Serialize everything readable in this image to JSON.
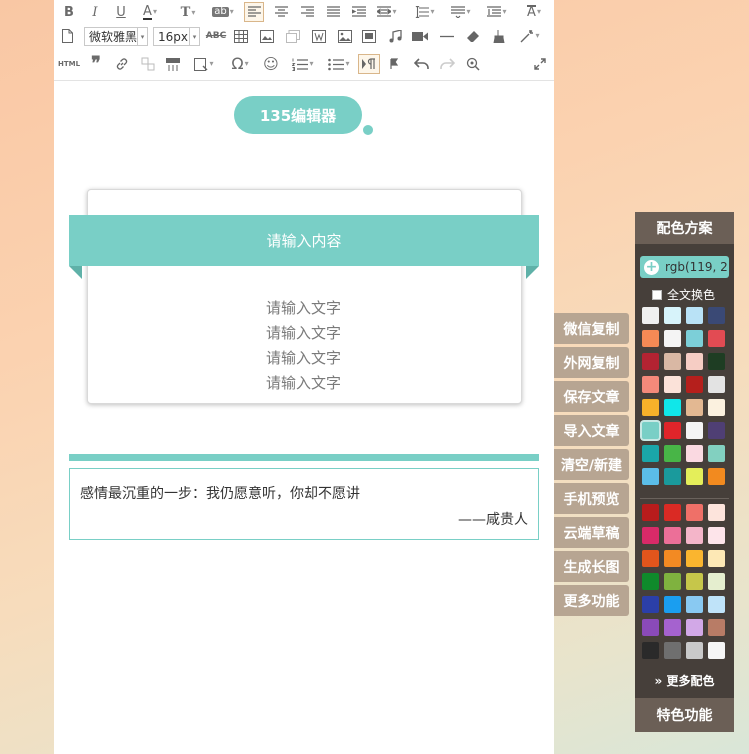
{
  "toolbar": {
    "font_family": "微软雅黑",
    "font_size": "16px",
    "html_label": "HTML",
    "abc_label": "ABC",
    "omega_label": "Ω"
  },
  "content": {
    "badge_title": "135编辑器",
    "card_heading": "请输入内容",
    "card_lines": [
      "请输入文字",
      "请输入文字",
      "请输入文字",
      "请输入文字"
    ],
    "quote_text": "感情最沉重的一步：我仍愿意听，你却不愿讲",
    "quote_author": "——咸贵人"
  },
  "side_buttons": [
    "微信复制",
    "外网复制",
    "保存文章",
    "导入文章",
    "清空/新建",
    "手机预览",
    "云端草稿",
    "生成长图",
    "更多功能"
  ],
  "palette": {
    "title": "配色方案",
    "current_color": "rgb(119, 2",
    "full_text_label": "全文换色",
    "more_label": "更多配色",
    "footer": "特色功能",
    "accent": "#79cfc6",
    "swatches": [
      [
        "#f0f0f0",
        "#d7f3fa",
        "#b9e2f6",
        "#3a4975"
      ],
      [
        "#f58a55",
        "#f4f4f4",
        "#7ccfd8",
        "#e24b53"
      ],
      [
        "#b32332",
        "#d9b8a4",
        "#f6cdc4",
        "#1e3d23"
      ],
      [
        "#f4897a",
        "#fbe2d9",
        "#b51f1c",
        "#e3e3e3"
      ],
      [
        "#f7b12a",
        "#10e7e9",
        "#e3b892",
        "#fbf1df"
      ],
      [
        "#79cfc6",
        "#e0252a",
        "#f4f4f4",
        "#4f3f74"
      ],
      [
        "#1aa6a9",
        "#48b547",
        "#fad9e1",
        "#82d0c0"
      ],
      [
        "#5bbde8",
        "#1a9a9c",
        "#e4ee5a",
        "#f28a1f"
      ]
    ],
    "swatches2": [
      [
        "#b81c1c",
        "#da2a24",
        "#ef7068",
        "#fde4dc"
      ],
      [
        "#d92a68",
        "#ec6f98",
        "#f4b5c9",
        "#fde4ea"
      ],
      [
        "#e2551c",
        "#f38a23",
        "#fab52f",
        "#fde8b5"
      ],
      [
        "#0f8a2b",
        "#7fb23f",
        "#c6c64a",
        "#e5eecf"
      ],
      [
        "#2b3fa8",
        "#1a9ef0",
        "#89c9f2",
        "#bfe3f9"
      ],
      [
        "#8a4ab9",
        "#a562cf",
        "#d2a8e7",
        "#b87c66"
      ],
      [
        "#2a2a2a",
        "#6f6f6f",
        "#c9c9c9",
        "#f6f6f6"
      ]
    ]
  }
}
